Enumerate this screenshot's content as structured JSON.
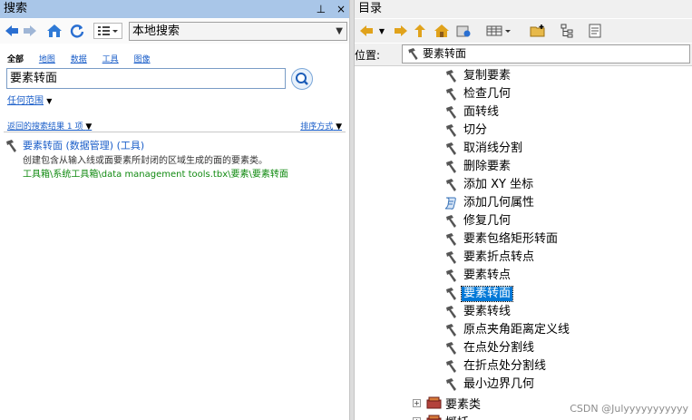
{
  "search_pane": {
    "title": "搜索",
    "pin_glyph": "⊥",
    "close_glyph": "×",
    "scope_select": "本地搜索",
    "category_tabs": [
      {
        "label": "全部",
        "active": true
      },
      {
        "label": "地图",
        "active": false
      },
      {
        "label": "数据",
        "active": false
      },
      {
        "label": "工具",
        "active": false
      },
      {
        "label": "图像",
        "active": false
      }
    ],
    "query": "要素转面",
    "scope_link": "任何范围",
    "results_count": "返回的搜索结果 1 项",
    "sort_label": "排序方式",
    "result": {
      "title": "要素转面 (数据管理) (工具)",
      "description": "创建包含从输入线或面要素所封闭的区域生成的面的要素类。",
      "path": "工具箱\\系统工具箱\\data management tools.tbx\\要素\\要素转面"
    }
  },
  "catalog_pane": {
    "title": "目录",
    "location_label": "位置:",
    "location_value": "要素转面",
    "tree_items": [
      {
        "label": "复制要素",
        "icon": "hammer-icon",
        "selected": false
      },
      {
        "label": "检查几何",
        "icon": "hammer-icon",
        "selected": false
      },
      {
        "label": "面转线",
        "icon": "hammer-icon",
        "selected": false
      },
      {
        "label": "切分",
        "icon": "hammer-icon",
        "selected": false
      },
      {
        "label": "取消线分割",
        "icon": "hammer-icon",
        "selected": false
      },
      {
        "label": "删除要素",
        "icon": "hammer-icon",
        "selected": false
      },
      {
        "label": "添加 XY 坐标",
        "icon": "hammer-icon",
        "selected": false
      },
      {
        "label": "添加几何属性",
        "icon": "script-icon",
        "selected": false
      },
      {
        "label": "修复几何",
        "icon": "hammer-icon",
        "selected": false
      },
      {
        "label": "要素包络矩形转面",
        "icon": "hammer-icon",
        "selected": false
      },
      {
        "label": "要素折点转点",
        "icon": "hammer-icon",
        "selected": false
      },
      {
        "label": "要素转点",
        "icon": "hammer-icon",
        "selected": false
      },
      {
        "label": "要素转面",
        "icon": "hammer-icon",
        "selected": true
      },
      {
        "label": "要素转线",
        "icon": "hammer-icon",
        "selected": false
      },
      {
        "label": "原点夹角距离定义线",
        "icon": "hammer-icon",
        "selected": false
      },
      {
        "label": "在点处分割线",
        "icon": "hammer-icon",
        "selected": false
      },
      {
        "label": "在折点处分割线",
        "icon": "hammer-icon",
        "selected": false
      },
      {
        "label": "最小边界几何",
        "icon": "hammer-icon",
        "selected": false
      }
    ],
    "toolsets": [
      {
        "label": "要素类",
        "expander": "+"
      },
      {
        "label": "概括",
        "expander": "+"
      }
    ]
  },
  "watermark": "CSDN @Julyyyyyyyyyyy"
}
